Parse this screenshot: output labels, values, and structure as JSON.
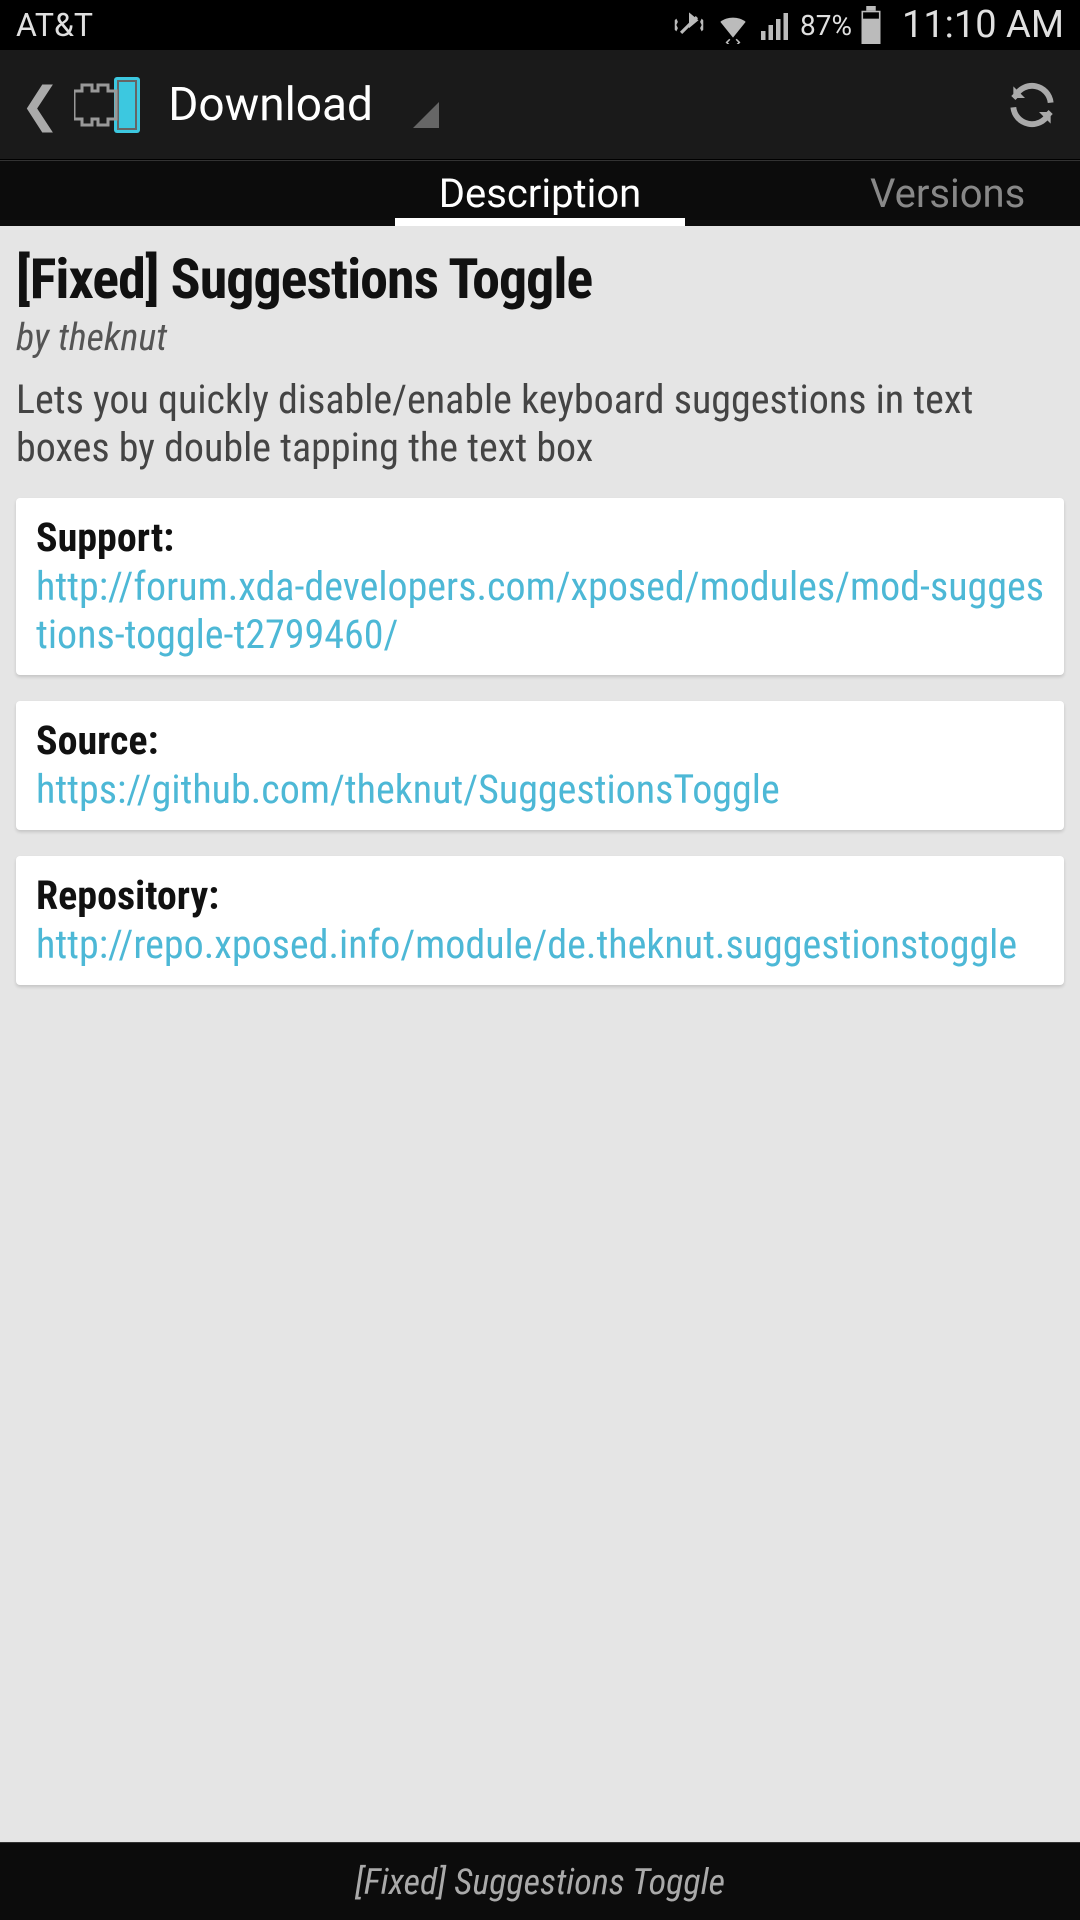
{
  "statusbar": {
    "carrier": "AT&T",
    "battery_pct": "87%",
    "time": "11:10 AM"
  },
  "header": {
    "title": "Download"
  },
  "tabs": {
    "description": "Description",
    "versions": "Versions"
  },
  "module": {
    "title": "[Fixed] Suggestions Toggle",
    "author": "by theknut",
    "description": "Lets you quickly disable/enable keyboard suggestions in text boxes by double tapping the text box"
  },
  "cards": {
    "support_label": "Support:",
    "support_url": "http://forum.xda-developers.com/xposed/modules/mod-suggestions-toggle-t2799460/",
    "source_label": "Source:",
    "source_url": "https://github.com/theknut/SuggestionsToggle",
    "repo_label": "Repository:",
    "repo_url": "http://repo.xposed.info/module/de.theknut.suggestionstoggle"
  },
  "footer": {
    "text": "[Fixed] Suggestions Toggle"
  }
}
